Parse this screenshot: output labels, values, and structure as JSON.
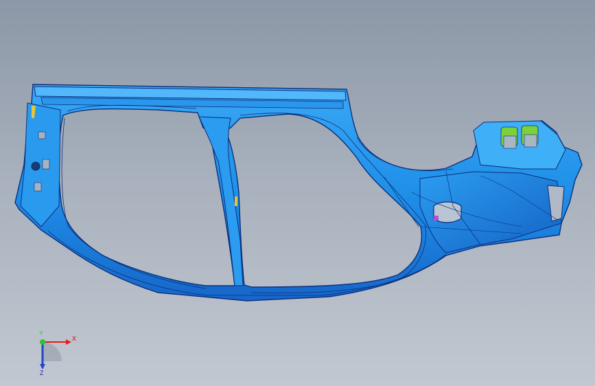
{
  "viewport": {
    "background_top": "#8c97a7",
    "background_bottom": "#c2c8d1"
  },
  "model": {
    "body_color": "#1f8fe8",
    "edge_color": "#0b2e7a",
    "highlight_color": "#64c6ff",
    "accent_green": "#7bd13a",
    "accent_yellow": "#e5c53a",
    "accent_magenta": "#c04ad8"
  },
  "triad": {
    "x_label": "X",
    "y_label": "Y",
    "z_label": "Z",
    "x_color": "#e21d1d",
    "y_color": "#27c23a",
    "z_color": "#2343c8"
  }
}
